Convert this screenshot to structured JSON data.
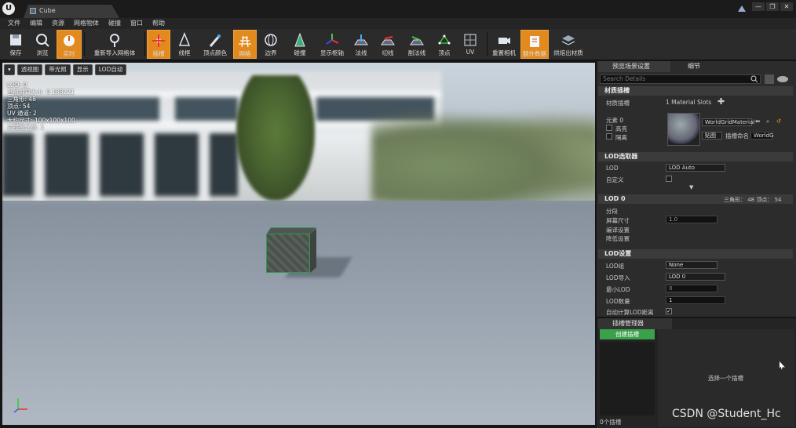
{
  "window": {
    "tab_title": "Cube",
    "controls": [
      "—",
      "❐",
      "✕"
    ]
  },
  "menu": [
    "文件",
    "编辑",
    "资源",
    "网格物体",
    "碰撞",
    "窗口",
    "帮助"
  ],
  "toolbar": {
    "items": [
      {
        "label": "保存",
        "icon": "save-icon",
        "active": false
      },
      {
        "label": "浏览",
        "icon": "browse-icon",
        "active": false
      },
      {
        "label": "实时",
        "icon": "realtime-icon",
        "active": true
      },
      {
        "label": "重新导入网格体",
        "icon": "reimport-icon",
        "active": false
      },
      {
        "label": "插槽",
        "icon": "socket-icon",
        "active": true
      },
      {
        "label": "线框",
        "icon": "wireframe-icon",
        "active": false
      },
      {
        "label": "顶点颜色",
        "icon": "vertex-color-icon",
        "active": false
      },
      {
        "label": "网格",
        "icon": "grid-icon",
        "active": true
      },
      {
        "label": "边界",
        "icon": "bounds-icon",
        "active": false
      },
      {
        "label": "碰撞",
        "icon": "collision-icon",
        "active": false
      },
      {
        "label": "显示枢轴",
        "icon": "pivot-icon",
        "active": false
      },
      {
        "label": "法线",
        "icon": "normals-icon",
        "active": false
      },
      {
        "label": "切线",
        "icon": "tangents-icon",
        "active": false
      },
      {
        "label": "副法线",
        "icon": "binormals-icon",
        "active": false
      },
      {
        "label": "顶点",
        "icon": "vertices-icon",
        "active": false
      },
      {
        "label": "UV",
        "icon": "uv-icon",
        "active": false
      },
      {
        "label": "重置相机",
        "icon": "reset-camera-icon",
        "active": false
      },
      {
        "label": "额外数据",
        "icon": "additional-data-icon",
        "active": true
      },
      {
        "label": "烘焙出材质",
        "icon": "bake-material-icon",
        "active": false
      }
    ]
  },
  "viewport": {
    "buttons": [
      "▾",
      "透视图",
      "带光照",
      "显示",
      "LOD自动"
    ],
    "stats": [
      "LOD: 0",
      "当前屏幕大小: 0.188221",
      "三角形: 48",
      "顶点: 54",
      "UV 通道: 2",
      "大约尺寸: 100x100x100",
      "对撞图元数: 1"
    ]
  },
  "details": {
    "tabs": [
      "预览场景设置",
      "细节"
    ],
    "search_placeholder": "Search Details",
    "material_section": {
      "title": "材质插槽",
      "row_label": "材质插槽",
      "slots_count": "1 Material Slots",
      "element_label": "元素 0",
      "highlight": "高亮",
      "isolate": "隔离",
      "material_name": "WorldGridMaterial",
      "texture_btn": "贴图",
      "slot_name_label": "插槽命名",
      "slot_name_value": "WorldG"
    },
    "lod_picker": {
      "title": "LOD选取器",
      "lod_label": "LOD",
      "lod_value": "LOD Auto",
      "custom_label": "自定义"
    },
    "lod0": {
      "title": "LOD 0",
      "tri_vert": "三角形： 48   顶点： 54",
      "sections": "分段",
      "screen_size_label": "屏幕尺寸",
      "screen_size_value": "1.0",
      "build_settings": "编译设置",
      "reduction_settings": "降低设置"
    },
    "lod_settings": {
      "title": "LOD设置",
      "lod_group_label": "LOD组",
      "lod_group_value": "None",
      "lod_import_label": "LOD导入",
      "lod_import_value": "LOD 0",
      "min_lod_label": "最小LOD",
      "min_lod_value": "0",
      "lod_count_label": "LOD数量",
      "lod_count_value": "1",
      "auto_compute_label": "自动计算LOD距离",
      "auto_compute_checked": true
    }
  },
  "socket_manager": {
    "tab": "插槽管理器",
    "create_button": "创建插槽",
    "empty_hint": "选择一个插槽",
    "count": "0个插槽"
  },
  "watermark": "CSDN @Student_Hc"
}
